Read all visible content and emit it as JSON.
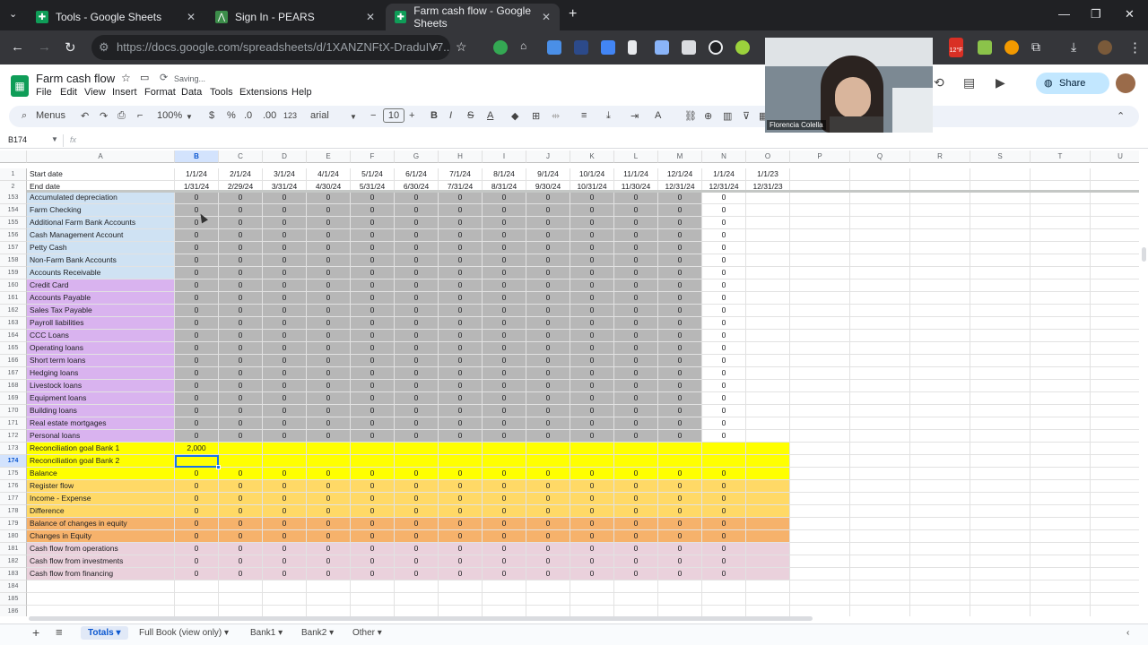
{
  "browser": {
    "tabs": [
      {
        "title": "Tools - Google Sheets"
      },
      {
        "title": "Sign In - PEARS"
      },
      {
        "title": "Farm cash flow - Google Sheets"
      }
    ],
    "url": "https://docs.google.com/spreadsheets/d/1XANZNFtX-DraduIV7..."
  },
  "extension_badge": "12°F",
  "app": {
    "doc_title": "Farm cash flow",
    "saving_status": "Saving...",
    "menu": [
      "File",
      "Edit",
      "View",
      "Insert",
      "Format",
      "Data",
      "Tools",
      "Extensions",
      "Help"
    ],
    "share_label": "Share"
  },
  "toolbar": {
    "menus_label": "Menus",
    "zoom": "100%",
    "currency": "$",
    "percent": "%",
    "dec_dec": ".0",
    "dec_inc": ".00",
    "format_123": "123",
    "font": "arial",
    "font_size": "10"
  },
  "formula_bar": {
    "name_box": "B174",
    "fx": "fx"
  },
  "video": {
    "person_name": "Florencia Colella"
  },
  "columns": [
    "A",
    "B",
    "C",
    "D",
    "E",
    "F",
    "G",
    "H",
    "I",
    "J",
    "K",
    "L",
    "M",
    "N",
    "O",
    "P",
    "Q",
    "R",
    "S",
    "T",
    "U"
  ],
  "header_rows": [
    {
      "num": "1",
      "label": "Start date",
      "values": [
        "1/1/24",
        "2/1/24",
        "3/1/24",
        "4/1/24",
        "5/1/24",
        "6/1/24",
        "7/1/24",
        "8/1/24",
        "9/1/24",
        "10/1/24",
        "11/1/24",
        "12/1/24",
        "1/1/24",
        "1/1/23"
      ]
    },
    {
      "num": "2",
      "label": "End date",
      "values": [
        "1/31/24",
        "2/29/24",
        "3/31/24",
        "4/30/24",
        "5/31/24",
        "6/30/24",
        "7/31/24",
        "8/31/24",
        "9/30/24",
        "10/31/24",
        "11/30/24",
        "12/31/24",
        "12/31/24",
        "12/31/23"
      ]
    }
  ],
  "rows": [
    {
      "num": "153",
      "label": "Accumulated depreciation",
      "fill": "blue",
      "zeros": 12,
      "n": "0"
    },
    {
      "num": "154",
      "label": "Farm Checking",
      "fill": "blue",
      "zeros": 12,
      "n": "0"
    },
    {
      "num": "155",
      "label": "Additional Farm Bank Accounts",
      "fill": "blue",
      "zeros": 12,
      "n": "0"
    },
    {
      "num": "156",
      "label": "Cash Management Account",
      "fill": "blue",
      "zeros": 12,
      "n": "0"
    },
    {
      "num": "157",
      "label": "Petty Cash",
      "fill": "blue",
      "zeros": 12,
      "n": "0"
    },
    {
      "num": "158",
      "label": "Non-Farm Bank Accounts",
      "fill": "blue",
      "zeros": 12,
      "n": "0"
    },
    {
      "num": "159",
      "label": "Accounts Receivable",
      "fill": "blue",
      "zeros": 12,
      "n": "0"
    },
    {
      "num": "160",
      "label": "Credit Card",
      "fill": "purple",
      "zeros": 12,
      "n": "0"
    },
    {
      "num": "161",
      "label": "Accounts Payable",
      "fill": "purple",
      "zeros": 12,
      "n": "0"
    },
    {
      "num": "162",
      "label": "Sales Tax Payable",
      "fill": "purple",
      "zeros": 12,
      "n": "0"
    },
    {
      "num": "163",
      "label": "Payroll liabilities",
      "fill": "purple",
      "zeros": 12,
      "n": "0"
    },
    {
      "num": "164",
      "label": "CCC Loans",
      "fill": "purple",
      "zeros": 12,
      "n": "0"
    },
    {
      "num": "165",
      "label": "Operating loans",
      "fill": "purple",
      "zeros": 12,
      "n": "0"
    },
    {
      "num": "166",
      "label": "Short term loans",
      "fill": "purple",
      "zeros": 12,
      "n": "0"
    },
    {
      "num": "167",
      "label": "Hedging loans",
      "fill": "purple",
      "zeros": 12,
      "n": "0"
    },
    {
      "num": "168",
      "label": "Livestock loans",
      "fill": "purple",
      "zeros": 12,
      "n": "0"
    },
    {
      "num": "169",
      "label": "Equipment loans",
      "fill": "purple",
      "zeros": 12,
      "n": "0"
    },
    {
      "num": "170",
      "label": "Building loans",
      "fill": "purple",
      "zeros": 12,
      "n": "0"
    },
    {
      "num": "171",
      "label": "Real estate mortgages",
      "fill": "purple",
      "zeros": 12,
      "n": "0"
    },
    {
      "num": "172",
      "label": "Personal loans",
      "fill": "purple",
      "zeros": 12,
      "n": "0"
    },
    {
      "num": "173",
      "label": "Reconciliation goal Bank 1",
      "fill": "yellow",
      "zeros": 0,
      "b": "2,000"
    },
    {
      "num": "174",
      "label": "Reconciliation goal Bank 2",
      "fill": "yellow",
      "zeros": 0,
      "selected": true
    },
    {
      "num": "175",
      "label": "Balance",
      "fill": "yellow",
      "zeros": 12,
      "n": "0"
    },
    {
      "num": "176",
      "label": "Register flow",
      "fill": "ltorange",
      "zeros": 12,
      "n": "0"
    },
    {
      "num": "177",
      "label": "Income - Expense",
      "fill": "ltorange",
      "zeros": 12,
      "n": "0"
    },
    {
      "num": "178",
      "label": "Difference",
      "fill": "ltorange",
      "zeros": 12,
      "n": "0"
    },
    {
      "num": "179",
      "label": "Balance of changes in equity",
      "fill": "orange",
      "zeros": 12,
      "n": "0"
    },
    {
      "num": "180",
      "label": "Changes in Equity",
      "fill": "orange",
      "zeros": 12,
      "n": "0"
    },
    {
      "num": "181",
      "label": "Cash flow from operations",
      "fill": "pink",
      "zeros": 12,
      "n": "0"
    },
    {
      "num": "182",
      "label": "Cash flow from investments",
      "fill": "pink",
      "zeros": 12,
      "n": "0"
    },
    {
      "num": "183",
      "label": "Cash flow from financing",
      "fill": "pink",
      "zeros": 12,
      "n": "0"
    },
    {
      "num": "184",
      "label": "",
      "fill": "none",
      "zeros": 0
    },
    {
      "num": "185",
      "label": "",
      "fill": "none",
      "zeros": 0
    },
    {
      "num": "186",
      "label": "",
      "fill": "none",
      "zeros": 0
    }
  ],
  "colors": {
    "blue": "#cfe2f3",
    "purple": "#d9b3ef",
    "yellow": "#ffff00",
    "ltorange": "#ffd966",
    "orange": "#f6b26b",
    "pink": "#ead1dc",
    "gray": "#b7b7b7",
    "accent": "#1a73e8"
  },
  "sheets": [
    "Totals",
    "Full Book (view only)",
    "Bank1",
    "Bank2",
    "Other"
  ]
}
